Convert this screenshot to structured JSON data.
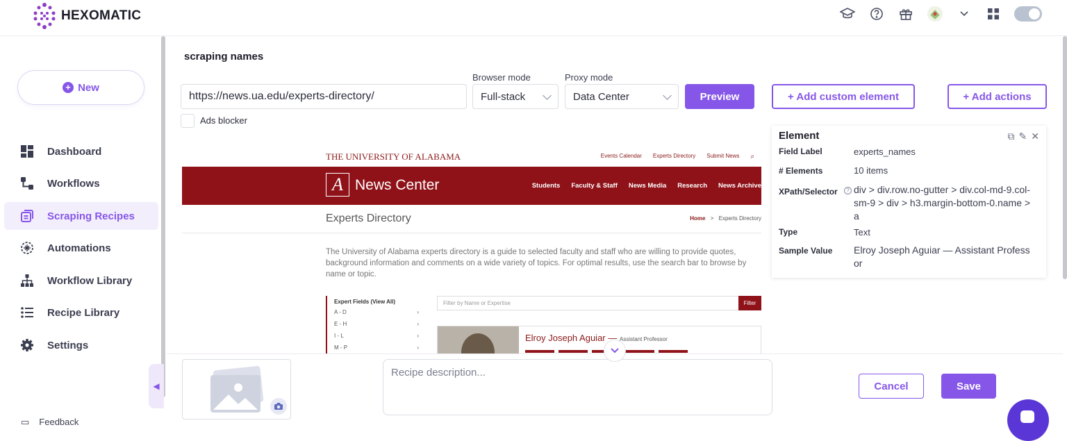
{
  "app": {
    "brand": "HEXOMATIC"
  },
  "sidebar": {
    "new_label": "New",
    "items": [
      {
        "label": "Dashboard",
        "icon": "dashboard-icon"
      },
      {
        "label": "Workflows",
        "icon": "workflows-icon"
      },
      {
        "label": "Scraping Recipes",
        "icon": "scraping-recipes-icon",
        "active": true
      },
      {
        "label": "Automations",
        "icon": "automations-icon"
      },
      {
        "label": "Workflow Library",
        "icon": "workflow-library-icon"
      },
      {
        "label": "Recipe Library",
        "icon": "recipe-library-icon"
      },
      {
        "label": "Settings",
        "icon": "gear-icon"
      }
    ],
    "feedback": "Feedback"
  },
  "recipe": {
    "title": "scraping names",
    "url": "https://news.ua.edu/experts-directory/",
    "browser_mode_label": "Browser mode",
    "browser_mode_value": "Full-stack",
    "proxy_mode_label": "Proxy mode",
    "proxy_mode_value": "Data Center",
    "preview_label": "Preview",
    "add_custom_label": "+ Add custom element",
    "add_actions_label": "+ Add actions",
    "ads_blocker_label": "Ads blocker"
  },
  "preview": {
    "university": "THE UNIVERSITY OF ALABAMA",
    "top_links": [
      "Events Calendar",
      "Experts Directory",
      "Submit News"
    ],
    "logo_letter": "A",
    "news_center": "News Center",
    "nav": [
      "Students",
      "Faculty & Staff",
      "News Media",
      "Research",
      "News Archive"
    ],
    "heading": "Experts Directory",
    "crumb_home": "Home",
    "crumb_sep": ">",
    "crumb_current": "Experts Directory",
    "intro": "The University of Alabama experts directory is a guide to selected faculty and staff who are willing to provide quotes, background information and comments on a wide variety of topics. For optimal results, use the search bar to browse by name or topic.",
    "fields_title": "Expert Fields (View All)",
    "fields": [
      "A - D",
      "E - H",
      "I - L",
      "M - P"
    ],
    "filter_placeholder": "Filter by Name or Expertise",
    "filter_button": "Filter",
    "expert_name": "Elroy Joseph Aguiar —",
    "expert_role": "Assistant Professor"
  },
  "element": {
    "title": "Element",
    "rows": [
      {
        "key": "Field Label",
        "value": "experts_names"
      },
      {
        "key": "# Elements",
        "value": "10 items"
      },
      {
        "key": "XPath/Selector",
        "value": "div > div.row.no-gutter > div.col-md-9.col-sm-9 > div > h3.margin-bottom-0.name > a"
      },
      {
        "key": "Type",
        "value": "Text"
      },
      {
        "key": "Sample Value",
        "value": "Elroy Joseph Aguiar — Assistant Professor"
      }
    ]
  },
  "bottom": {
    "description_placeholder": "Recipe description...",
    "cancel_label": "Cancel",
    "save_label": "Save"
  },
  "colors": {
    "accent": "#8656e8",
    "ua_crimson": "#8f1219"
  }
}
